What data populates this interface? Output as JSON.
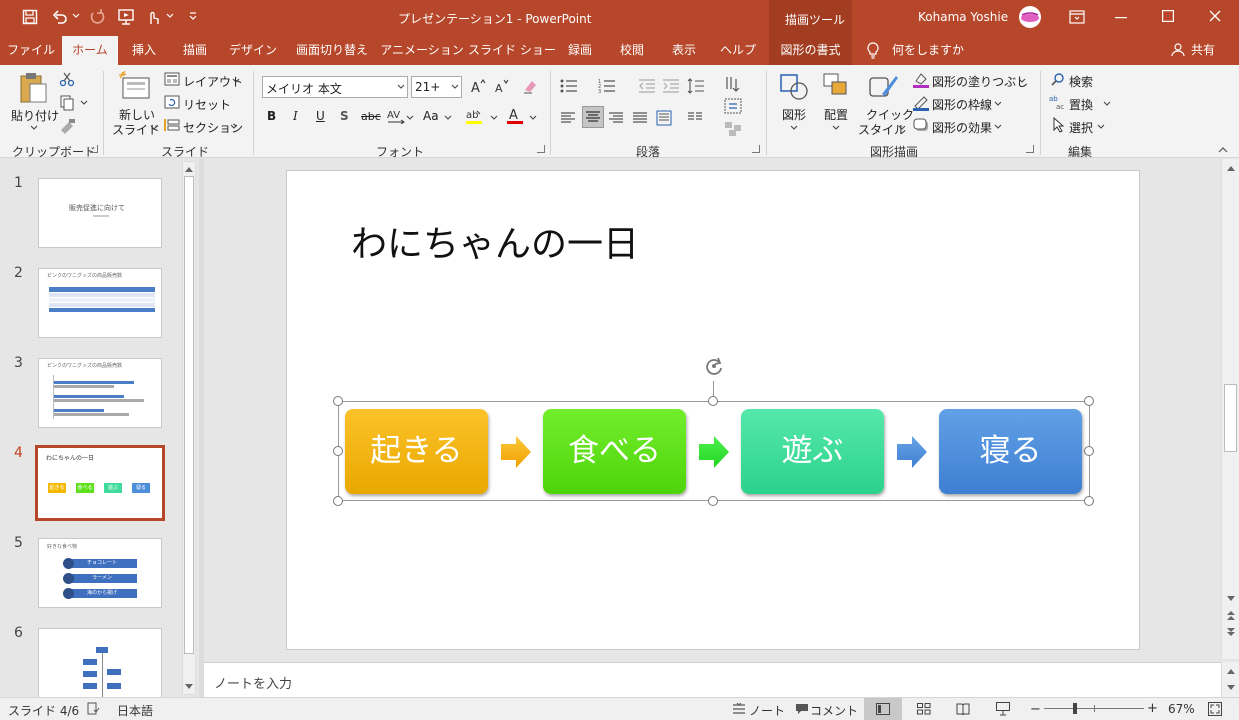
{
  "window": {
    "title": "プレゼンテーション1 - PowerPoint",
    "context_tool": "描画ツール",
    "user": "Kohama Yoshie"
  },
  "tabs": [
    "ファイル",
    "ホーム",
    "挿入",
    "描画",
    "デザイン",
    "画面切り替え",
    "アニメーション",
    "スライド ショー",
    "録画",
    "校閲",
    "表示",
    "ヘルプ",
    "図形の書式"
  ],
  "tell_me": "何をしますか",
  "share": "共有",
  "ribbon": {
    "clipboard": {
      "paste": "貼り付け",
      "group": "クリップボード"
    },
    "slides": {
      "new_slide_1": "新しい",
      "new_slide_2": "スライド",
      "layout": "レイアウト",
      "reset": "リセット",
      "section": "セクション",
      "group": "スライド"
    },
    "font": {
      "name": "メイリオ 本文",
      "size": "21+",
      "group": "フォント"
    },
    "paragraph": {
      "group": "段落"
    },
    "drawing": {
      "shapes": "図形",
      "arrange": "配置",
      "quick_styles_1": "クイック",
      "quick_styles_2": "スタイル",
      "fill": "図形の塗りつぶし",
      "outline": "図形の枠線",
      "effects": "図形の効果",
      "group": "図形描画"
    },
    "editing": {
      "find": "検索",
      "replace": "置換",
      "select": "選択",
      "group": "編集"
    }
  },
  "thumbnails": [
    {
      "num": "1",
      "title": "販売促進に向けて"
    },
    {
      "num": "2",
      "title": "ピンクのワニグッズの商品販売数"
    },
    {
      "num": "3",
      "title": "ピンクのワニグッズの商品販売数"
    },
    {
      "num": "4",
      "title": "わにちゃんの一日",
      "steps": [
        "起きる",
        "食べる",
        "遊ぶ",
        "寝る"
      ]
    },
    {
      "num": "5",
      "title": "好きな食べ物",
      "items": [
        "チョコレート",
        "ラーメン",
        "海のから揚げ"
      ]
    },
    {
      "num": "6",
      "title": ""
    }
  ],
  "selected_slide": 4,
  "slide": {
    "title": "わにちゃんの一日",
    "steps": [
      {
        "label": "起きる",
        "color": "#f5b800"
      },
      {
        "label": "食べる",
        "color": "#5ee01c"
      },
      {
        "label": "遊ぶ",
        "color": "#3edb9c"
      },
      {
        "label": "寝る",
        "color": "#4d8edb"
      }
    ],
    "arrow_colors": [
      "#f5b800",
      "#3be63b",
      "#4d8edb"
    ]
  },
  "notes_placeholder": "ノートを入力",
  "status": {
    "slide": "スライド 4/6",
    "language": "日本語",
    "notes": "ノート",
    "comments": "コメント",
    "zoom": "67%"
  },
  "colors": {
    "accent": "#b7472a"
  }
}
